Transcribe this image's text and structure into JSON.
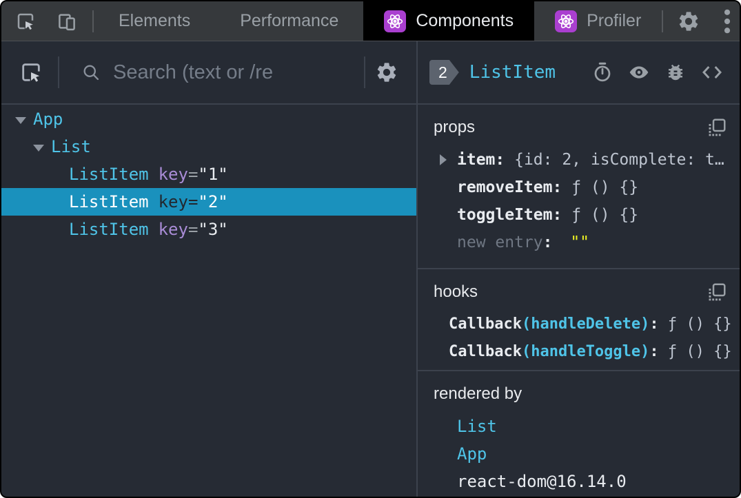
{
  "colors": {
    "accent_cyan": "#4fc4e8",
    "selected_row_blue": "#1a91bd",
    "react_purple": "#aa3fd0",
    "string_yellow": "#edf222",
    "attr_purple": "#a98cd6",
    "panel_background": "#262b34",
    "topbar_background": "#36393c"
  },
  "icons": {
    "inspect": "cursor-in-box",
    "device": "phone-and-tablet",
    "react": "atom-symbol",
    "settings": "gear",
    "menu": "vertical-kebab-dots",
    "search": "magnifier",
    "suspense": "stopwatch",
    "inspect_dom": "eye",
    "log_console": "bug",
    "view_source": "angle-brackets",
    "copy": "copy-square-dashed"
  },
  "topbar": {
    "tabs": {
      "elements": "Elements",
      "performance": "Performance",
      "components": "Components",
      "profiler": "Profiler"
    }
  },
  "left_panel": {
    "toolbar": {
      "search_placeholder": "Search (text or /re"
    },
    "tree": [
      {
        "name": "App",
        "depth": 0,
        "expanded": true
      },
      {
        "name": "List",
        "depth": 1,
        "expanded": true
      },
      {
        "name": "ListItem",
        "depth": 2,
        "attr_name": "key",
        "attr_eq": "=",
        "attr_value": "\"1\""
      },
      {
        "name": "ListItem",
        "depth": 2,
        "attr_name": "key",
        "attr_eq": "=",
        "attr_value": "\"2\"",
        "selected": true
      },
      {
        "name": "ListItem",
        "depth": 2,
        "attr_name": "key",
        "attr_eq": "=",
        "attr_value": "\"3\""
      }
    ]
  },
  "right_panel": {
    "header": {
      "badge": "2",
      "component_name": "ListItem"
    },
    "props": {
      "title": "props",
      "rows": [
        {
          "name": "item",
          "sep": ": ",
          "value": "{id: 2, isComplete: t…",
          "expandable": true
        },
        {
          "name": "removeItem",
          "sep": ": ",
          "value": "ƒ () {}"
        },
        {
          "name": "toggleItem",
          "sep": ": ",
          "value": "ƒ () {}"
        },
        {
          "name": "new entry",
          "sep": ": ",
          "value": "\"\"",
          "placeholder_row": true
        }
      ]
    },
    "hooks": {
      "title": "hooks",
      "rows": [
        {
          "name": "Callback",
          "paren": "(handleDelete)",
          "sep": ": ",
          "value": "ƒ () {}"
        },
        {
          "name": "Callback",
          "paren": "(handleToggle)",
          "sep": ": ",
          "value": "ƒ () {}"
        }
      ]
    },
    "rendered_by": {
      "title": "rendered by",
      "items": [
        "List",
        "App",
        "react-dom@16.14.0"
      ]
    }
  }
}
